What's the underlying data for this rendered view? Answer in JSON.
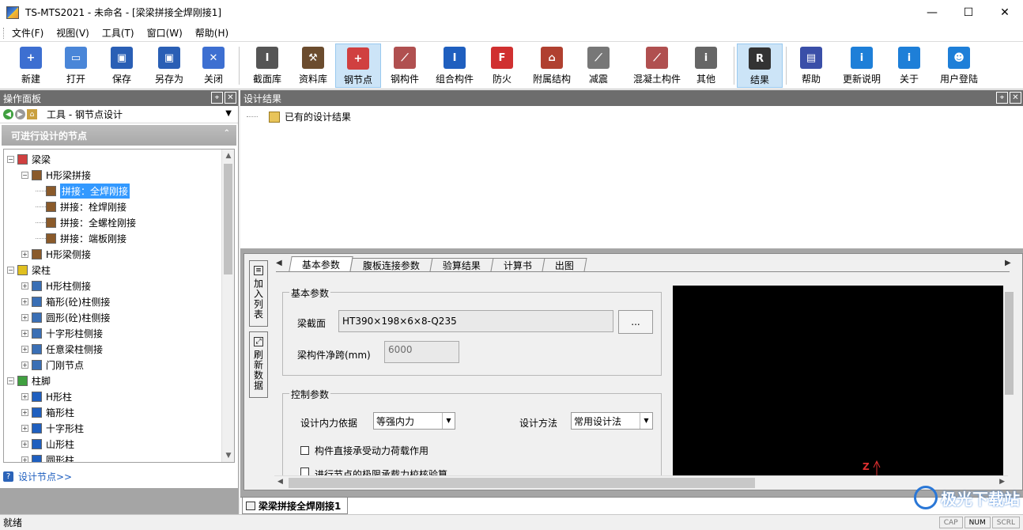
{
  "window": {
    "title": "TS-MTS2021 - 未命名 - [梁梁拼接全焊刚接1]",
    "minimize": "—",
    "maximize": "☐",
    "close": "✕"
  },
  "menu": {
    "items": [
      "文件(F)",
      "视图(V)",
      "工具(T)",
      "窗口(W)",
      "帮助(H)"
    ]
  },
  "toolbar": {
    "buttons": [
      {
        "label": "新建",
        "icon": "new-file-icon",
        "color": "#3d6fd1",
        "glyph": "+"
      },
      {
        "label": "打开",
        "icon": "folder-open-icon",
        "color": "#4a86d8",
        "glyph": "▭"
      },
      {
        "label": "保存",
        "icon": "save-icon",
        "color": "#2a5fb5",
        "glyph": "▣"
      },
      {
        "label": "另存为",
        "icon": "save-as-icon",
        "color": "#2a5fb5",
        "glyph": "▣"
      },
      {
        "label": "关闭",
        "icon": "close-file-icon",
        "color": "#3d6fd1",
        "glyph": "✕"
      },
      {
        "label": "截面库",
        "icon": "section-library-icon",
        "color": "#555",
        "glyph": "I"
      },
      {
        "label": "资料库",
        "icon": "tools-library-icon",
        "color": "#6b4c2e",
        "glyph": "⚒"
      },
      {
        "label": "钢节点",
        "icon": "steel-joint-icon",
        "color": "#d04040",
        "glyph": "+"
      },
      {
        "label": "钢构件",
        "icon": "steel-member-icon",
        "color": "#b05050",
        "glyph": "⟋"
      },
      {
        "label": "组合构件",
        "icon": "composite-member-icon",
        "color": "#1f5fbf",
        "glyph": "I"
      },
      {
        "label": "防火",
        "icon": "fire-icon",
        "color": "#d03030",
        "glyph": "F"
      },
      {
        "label": "附属结构",
        "icon": "auxiliary-structure-icon",
        "color": "#b04030",
        "glyph": "⌂"
      },
      {
        "label": "减震",
        "icon": "damping-icon",
        "color": "#777",
        "glyph": "⟋"
      },
      {
        "label": "混凝土构件",
        "icon": "concrete-member-icon",
        "color": "#b05050",
        "glyph": "⟋"
      },
      {
        "label": "其他",
        "icon": "other-icon",
        "color": "#666",
        "glyph": "i"
      },
      {
        "label": "结果",
        "icon": "result-icon",
        "color": "#333",
        "glyph": "R"
      },
      {
        "label": "帮助",
        "icon": "help-book-icon",
        "color": "#3a4fa8",
        "glyph": "▤"
      },
      {
        "label": "更新说明",
        "icon": "update-info-icon",
        "color": "#1e7fd8",
        "glyph": "i"
      },
      {
        "label": "关于",
        "icon": "about-icon",
        "color": "#1e7fd8",
        "glyph": "i"
      },
      {
        "label": "用户登陆",
        "icon": "users-icon",
        "color": "#1e7fd8",
        "glyph": "☻"
      }
    ]
  },
  "left_panel": {
    "header": "操作面板",
    "tool_title": "工具 - 钢节点设计",
    "section_title": "可进行设计的节点",
    "tree": [
      {
        "label": "梁梁",
        "level": 0,
        "expander": "−",
        "icon_color": "#d04040"
      },
      {
        "label": "H形梁拼接",
        "level": 1,
        "expander": "−",
        "icon_color": "#8a5a2a"
      },
      {
        "label": "拼接：全焊刚接",
        "level": 2,
        "expander": "",
        "icon_color": "#8a5a2a",
        "selected": true
      },
      {
        "label": "拼接：栓焊刚接",
        "level": 2,
        "expander": "",
        "icon_color": "#8a5a2a"
      },
      {
        "label": "拼接：全螺栓刚接",
        "level": 2,
        "expander": "",
        "icon_color": "#8a5a2a"
      },
      {
        "label": "拼接：端板刚接",
        "level": 2,
        "expander": "",
        "icon_color": "#8a5a2a"
      },
      {
        "label": "H形梁侧接",
        "level": 1,
        "expander": "+",
        "icon_color": "#8a5a2a"
      },
      {
        "label": "梁柱",
        "level": 0,
        "expander": "−",
        "icon_color": "#e0c020"
      },
      {
        "label": "H形柱侧接",
        "level": 1,
        "expander": "+",
        "icon_color": "#3a6fb5"
      },
      {
        "label": "箱形(砼)柱侧接",
        "level": 1,
        "expander": "+",
        "icon_color": "#3a6fb5"
      },
      {
        "label": "圆形(砼)柱侧接",
        "level": 1,
        "expander": "+",
        "icon_color": "#3a6fb5"
      },
      {
        "label": "十字形柱侧接",
        "level": 1,
        "expander": "+",
        "icon_color": "#3a6fb5"
      },
      {
        "label": "任意梁柱侧接",
        "level": 1,
        "expander": "+",
        "icon_color": "#3a6fb5"
      },
      {
        "label": "门刚节点",
        "level": 1,
        "expander": "+",
        "icon_color": "#3a6fb5"
      },
      {
        "label": "柱脚",
        "level": 0,
        "expander": "−",
        "icon_color": "#40a040"
      },
      {
        "label": "H形柱",
        "level": 1,
        "expander": "+",
        "icon_color": "#1f5fbf"
      },
      {
        "label": "箱形柱",
        "level": 1,
        "expander": "+",
        "icon_color": "#1f5fbf"
      },
      {
        "label": "十字形柱",
        "level": 1,
        "expander": "+",
        "icon_color": "#1f5fbf"
      },
      {
        "label": "山形柱",
        "level": 1,
        "expander": "+",
        "icon_color": "#1f5fbf"
      },
      {
        "label": "圆形柱",
        "level": 1,
        "expander": "+",
        "icon_color": "#1f5fbf"
      }
    ],
    "design_link": "设计节点>>"
  },
  "right_panel": {
    "header": "设计结果",
    "existing_results": "已有的设计结果",
    "side_buttons": {
      "add_to_list": "加入列表",
      "refresh_data": "刷新数据"
    },
    "tabs": [
      "基本参数",
      "腹板连接参数",
      "验算结果",
      "计算书",
      "出图"
    ],
    "active_tab": "基本参数",
    "basic_group": {
      "title": "基本参数",
      "beam_section_label": "梁截面",
      "beam_section_value": "HT390×198×6×8-Q235",
      "browse_button": "...",
      "span_label": "梁构件净跨(mm)",
      "span_value": "6000"
    },
    "control_group": {
      "title": "控制参数",
      "force_basis_label": "设计内力依据",
      "force_basis_value": "等强内力",
      "method_label": "设计方法",
      "method_value": "常用设计法",
      "check_dynamic": "构件直接承受动力荷载作用",
      "check_ultimate": "进行节点的极限承载力校核验算"
    },
    "canvas": {
      "axis_label": "Z",
      "background": "#000000",
      "axis_color": "#e03030"
    },
    "doc_tab": "梁梁拼接全焊刚接1"
  },
  "watermark": "极光下载站",
  "status": {
    "text": "就绪",
    "indicators": [
      "CAP",
      "NUM",
      "SCRL"
    ],
    "active": [
      "NUM"
    ]
  },
  "colors": {
    "panel_header": "#6d6d6d",
    "selection": "#3399ff",
    "active_toolbar": "#cce4f7"
  }
}
